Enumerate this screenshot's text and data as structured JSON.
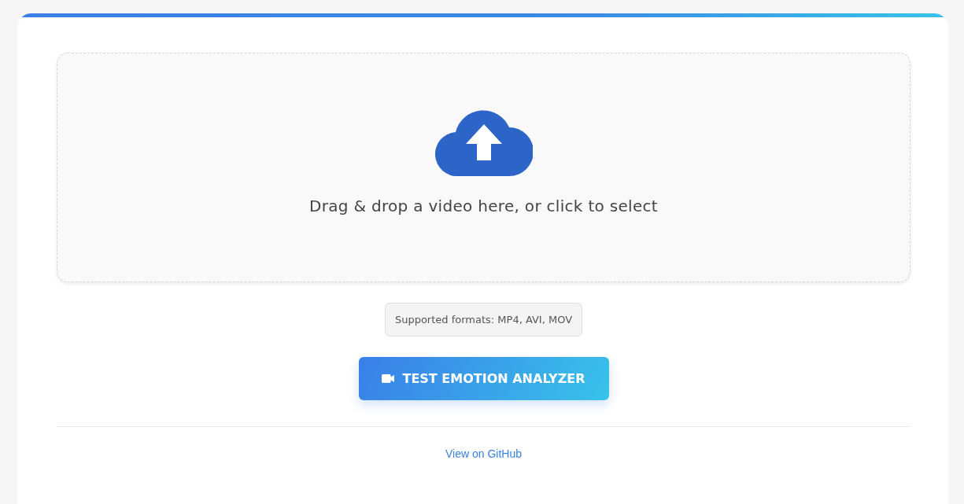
{
  "dropzone": {
    "prompt": "Drag & drop a video here, or click to select"
  },
  "formats_note": "Supported formats: MP4, AVI, MOV",
  "primary_button": {
    "label": "TEST EMOTION ANALYZER"
  },
  "footer_link": "View on GitHub"
}
